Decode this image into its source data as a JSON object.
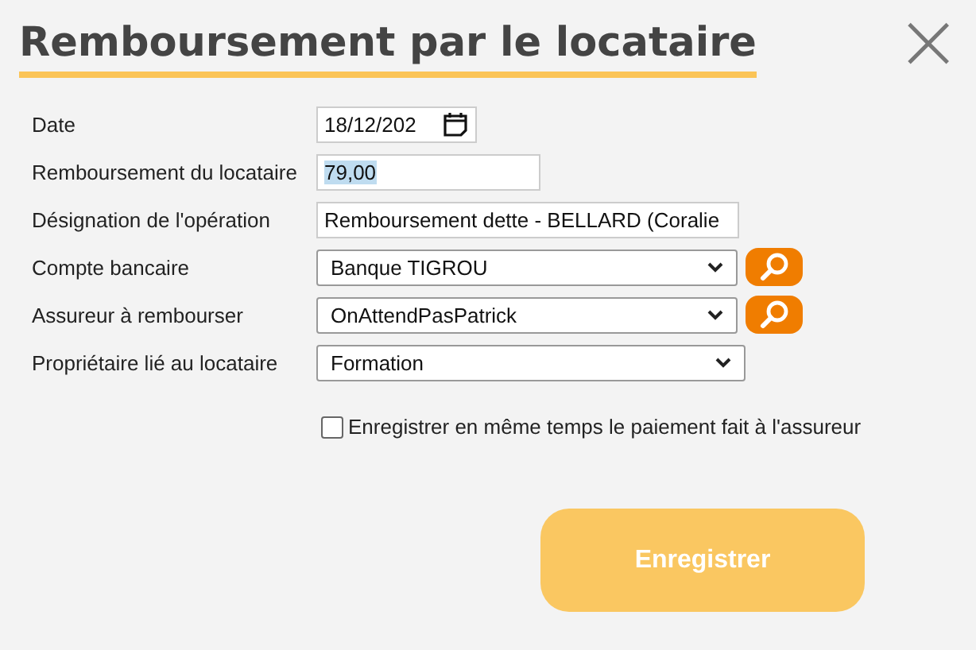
{
  "dialog": {
    "title": "Remboursement par le locataire",
    "close_icon": "×"
  },
  "fields": [
    {
      "kind": "date",
      "label": "Date",
      "value": "18/12/202"
    },
    {
      "kind": "amount",
      "label": "Remboursement du locataire",
      "value": "79,00",
      "highlighted": true
    },
    {
      "kind": "text",
      "label": "Désignation de l'opération",
      "value": "Remboursement dette - BELLARD (Coralie",
      "highlighted": false
    },
    {
      "kind": "select_search",
      "label": "Compte bancaire",
      "value": "Banque TIGROU"
    },
    {
      "kind": "select_search",
      "label": "Assureur à rembourser",
      "value": "OnAttendPasPatrick"
    },
    {
      "kind": "select",
      "label": "Propriétaire lié au locataire",
      "value": "Formation"
    }
  ],
  "checkbox": {
    "label": "Enregistrer en même temps le paiement fait à l'assureur",
    "checked": false
  },
  "submit": {
    "label": "Enregistrer",
    "disabled": true
  }
}
